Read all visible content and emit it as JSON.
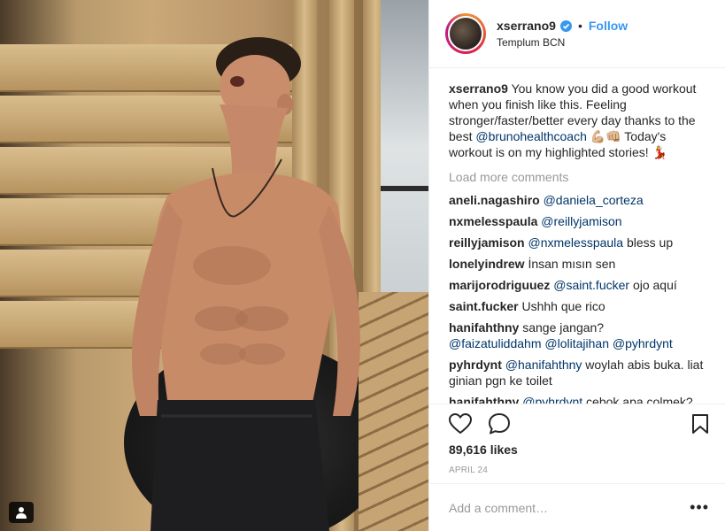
{
  "photo": {
    "alt_icon": "user-tag-icon"
  },
  "header": {
    "username": "xserrano9",
    "verified_icon": "verified-badge-icon",
    "separator": "•",
    "follow_label": "Follow",
    "location": "Templum BCN"
  },
  "caption": {
    "user": "xserrano9",
    "text_1": " You know you did a good workout when you finish like this. Feeling stronger/faster/better every day thanks to the best ",
    "mention": "@brunohealthcoach",
    "text_2": " 💪🏼👊🏼 Today's workout is on my highlighted stories! 💃🏼"
  },
  "load_more": "Load more comments",
  "comments": [
    {
      "user": "aneli.nagashiro",
      "mentions": [
        "@daniela_corteza"
      ],
      "text": ""
    },
    {
      "user": "nxmelesspaula",
      "mentions": [
        "@reillyjamison"
      ],
      "text": ""
    },
    {
      "user": "reillyjamison",
      "mentions": [
        "@nxmelesspaula"
      ],
      "text": " bless up"
    },
    {
      "user": "lonelyindrew",
      "mentions": [],
      "text": "İnsan mısın sen"
    },
    {
      "user": "marijorodriguuez",
      "mentions": [
        "@saint.fucker"
      ],
      "text": " ojo aquí"
    },
    {
      "user": "saint.fucker",
      "mentions": [],
      "text": "Ushhh que rico"
    },
    {
      "user": "hanifahthny",
      "mentions": [
        "@faizatuliddahm",
        "@lolitajihan",
        "@pyhrdynt"
      ],
      "text": "sange jangan?"
    },
    {
      "user": "pyhrdynt",
      "mentions": [
        "@hanifahthny"
      ],
      "text": " woylah abis buka. liat ginian pgn ke toilet"
    },
    {
      "user": "hanifahthny",
      "mentions": [
        "@pyhrdynt"
      ],
      "text": " cebok apa colmek?"
    }
  ],
  "actions": {
    "like_icon": "heart-icon",
    "comment_icon": "comment-bubble-icon",
    "save_icon": "bookmark-icon"
  },
  "likes": "89,616 likes",
  "date": "APRIL 24",
  "add_comment": {
    "placeholder": "Add a comment…",
    "more_label": "•••"
  },
  "colors": {
    "link": "#3897f0",
    "mention": "#003569",
    "muted": "#999999"
  }
}
